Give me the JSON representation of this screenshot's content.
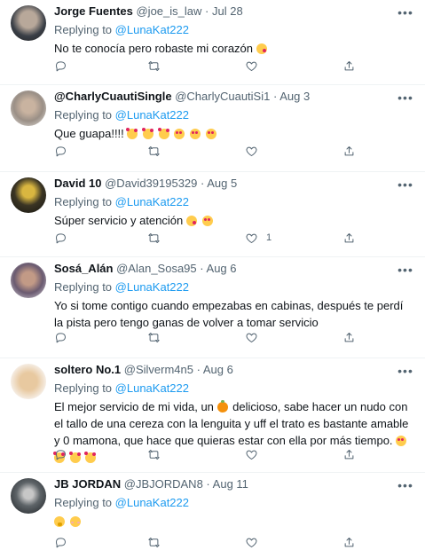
{
  "tweets": [
    {
      "name": "Jorge Fuentes",
      "handle": "@joe_is_law",
      "dot": "·",
      "date": "Jul 28",
      "reply_prefix": "Replying to",
      "mention": "@LunaKat222",
      "text": "No te conocía pero robaste mi corazón",
      "emojis": [
        "kiss"
      ],
      "like_count": ""
    },
    {
      "name": "@CharlyCuautiSingle",
      "handle": "@CharlyCuautiSi1",
      "dot": "·",
      "date": "Aug 3",
      "reply_prefix": "Replying to",
      "mention": "@LunaKat222",
      "text": "Que guapa!!!!",
      "emojis": [
        "hearts",
        "hearts",
        "hearts",
        "hearteyes",
        "hearteyes",
        "hearteyes"
      ],
      "like_count": ""
    },
    {
      "name": "David 10",
      "handle": "@David39195329",
      "dot": "·",
      "date": "Aug 5",
      "reply_prefix": "Replying to",
      "mention": "@LunaKat222",
      "text": "Súper servicio y atención",
      "emojis": [
        "kiss",
        "hearteyes"
      ],
      "like_count": "1"
    },
    {
      "name": "Sosá_Alán",
      "handle": "@Alan_Sosa95",
      "dot": "·",
      "date": "Aug 6",
      "reply_prefix": "Replying to",
      "mention": "@LunaKat222",
      "text": "Yo si tome contigo cuando empezabas en cabinas, después te perdí la pista pero tengo ganas de volver a tomar servicio",
      "emojis": [],
      "like_count": ""
    },
    {
      "name": "soltero No.1",
      "handle": "@Silverm4n5",
      "dot": "·",
      "date": "Aug 6",
      "reply_prefix": "Replying to",
      "mention": "@LunaKat222",
      "text_before": "El mejor servicio de mi vida, un",
      "text": "delicioso, sabe hacer un nudo con el tallo de una cereza con la lenguita y uff el trato es bastante amable y 0 mamona, que hace que quieras estar con ella por más tiempo.",
      "emojis": [
        "hearteyes",
        "hearts",
        "hearts",
        "hearts"
      ],
      "like_count": ""
    },
    {
      "name": "JB JORDAN",
      "handle": "@JBJORDAN8",
      "dot": "·",
      "date": "Aug 11",
      "reply_prefix": "Replying to",
      "mention": "@LunaKat222",
      "text": "",
      "emojis": [
        "hush",
        "blush"
      ],
      "like_count": ""
    }
  ],
  "icons": {
    "more": "more-icon",
    "reply": "reply-icon",
    "retweet": "retweet-icon",
    "like": "like-icon",
    "share": "share-icon"
  },
  "colors": {
    "mention": "#1d9bf0",
    "secondary_text": "#536471",
    "divider": "#eff3f4"
  }
}
